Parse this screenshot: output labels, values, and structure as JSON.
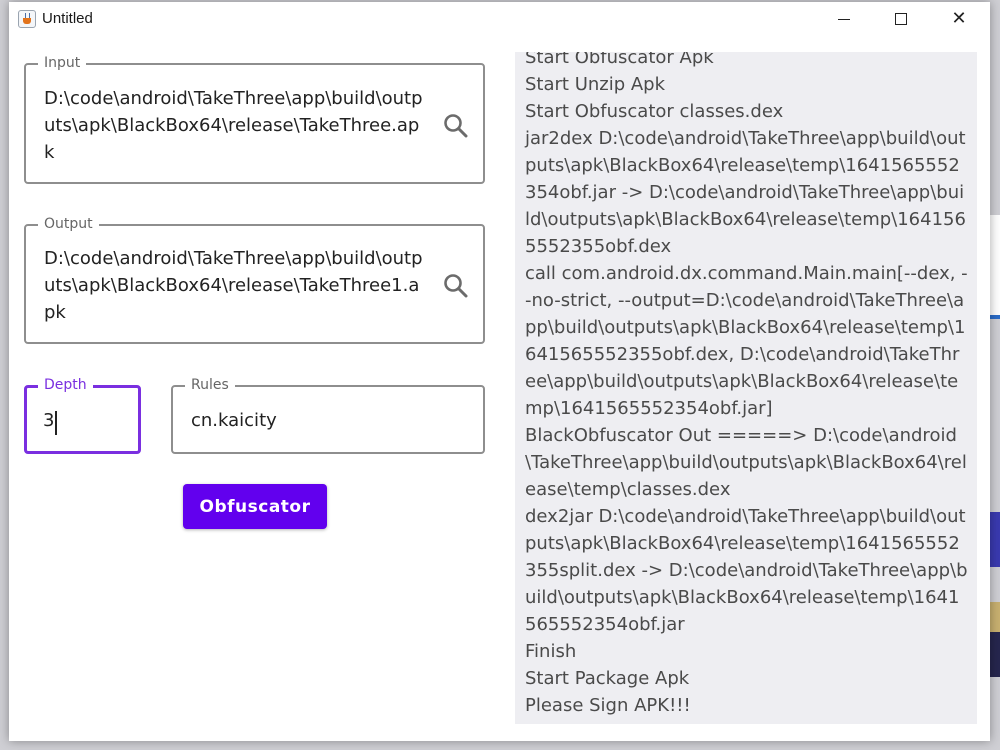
{
  "window": {
    "title": "Untitled",
    "minimize_glyph": "",
    "close_glyph": "✕"
  },
  "input": {
    "legend": "Input",
    "value": "D:\\code\\android\\TakeThree\\app\\build\\outputs\\apk\\BlackBox64\\release\\TakeThree.apk",
    "icon": "search-icon"
  },
  "output": {
    "legend": "Output",
    "value": "D:\\code\\android\\TakeThree\\app\\build\\outputs\\apk\\BlackBox64\\release\\TakeThree1.apk",
    "icon": "search-icon"
  },
  "depth": {
    "legend": "Depth",
    "value": "3",
    "accent": "#7a2fe0"
  },
  "rules": {
    "legend": "Rules",
    "value": "cn.kaicity"
  },
  "obfuscator_button": {
    "label": "Obfuscator",
    "color": "#6200ee"
  },
  "log": {
    "lines": [
      "Start Obfuscator Apk",
      "Start Unzip Apk",
      "Start Obfuscator classes.dex",
      "jar2dex D:\\code\\android\\TakeThree\\app\\build\\outputs\\apk\\BlackBox64\\release\\temp\\1641565552354obf.jar -> D:\\code\\android\\TakeThree\\app\\build\\outputs\\apk\\BlackBox64\\release\\temp\\1641565552355obf.dex",
      "call com.android.dx.command.Main.main[--dex, --no-strict, --output=D:\\code\\android\\TakeThree\\app\\build\\outputs\\apk\\BlackBox64\\release\\temp\\1641565552355obf.dex, D:\\code\\android\\TakeThree\\app\\build\\outputs\\apk\\BlackBox64\\release\\temp\\1641565552354obf.jar]",
      "BlackObfuscator Out =====> D:\\code\\android\\TakeThree\\app\\build\\outputs\\apk\\BlackBox64\\release\\temp\\classes.dex",
      "dex2jar D:\\code\\android\\TakeThree\\app\\build\\outputs\\apk\\BlackBox64\\release\\temp\\1641565552355split.dex -> D:\\code\\android\\TakeThree\\app\\build\\outputs\\apk\\BlackBox64\\release\\temp\\1641565552354obf.jar",
      "Finish",
      "Start Package Apk",
      "Please Sign APK!!!"
    ],
    "background": "#eeeef2"
  }
}
